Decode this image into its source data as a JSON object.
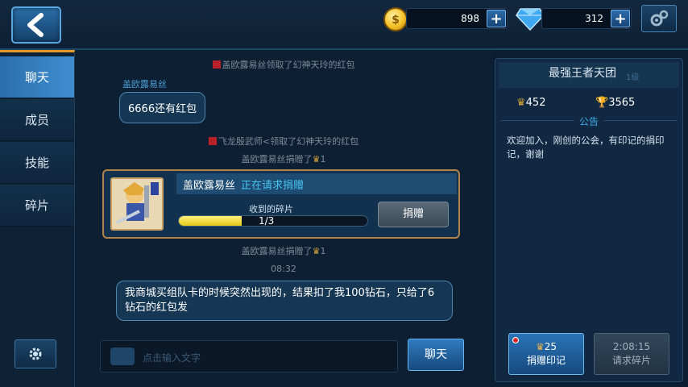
{
  "topbar": {
    "coins": "898",
    "gems": "312",
    "plus": "+"
  },
  "sidebar": {
    "items": [
      {
        "label": "聊天",
        "active": true
      },
      {
        "label": "成员",
        "active": false
      },
      {
        "label": "技能",
        "active": false
      },
      {
        "label": "碎片",
        "active": false
      }
    ]
  },
  "chat": {
    "system_1": "盖欧露易丝领取了幻神天玲的红包",
    "speaker_1": "盖欧露易丝",
    "bubble_1": "6666还有红包",
    "system_2": "飞龙殷武师<领取了幻神天玲的红包",
    "system_3_prefix": "盖欧露易丝捐赠了",
    "system_3_suffix": "1",
    "donate_card": {
      "name": "盖欧露易丝",
      "status": "正在请求捐赠",
      "fragments_label": "收到的碎片",
      "count": "1/3",
      "progress": 0.3333,
      "button": "捐赠"
    },
    "system_4_prefix": "盖欧露易丝捐赠了",
    "system_4_suffix": "1",
    "time": "08:32",
    "bubble_2": "我商城买组队卡的时候突然出现的，结果扣了我100钻石，只给了6钻石的红包发",
    "input_placeholder": "点击输入文字",
    "send": "聊天"
  },
  "guild": {
    "name": "最强王者天团",
    "level": "1级",
    "stat_medals": "452",
    "stat_trophies": "3565",
    "notice_title": "公告",
    "notice": "欢迎加入，刚创的公会，有印记的捐印记，谢谢",
    "donate_marks_count": "25",
    "donate_marks_label": "捐赠印记",
    "timer": "2:08:15",
    "request_fragments": "请求碎片"
  },
  "colors": {
    "accent": "#2a6fae",
    "sidebar_active_top": "#e49a2a",
    "link_blue": "#48c4f0",
    "progress_fill": "#e3c81a"
  }
}
